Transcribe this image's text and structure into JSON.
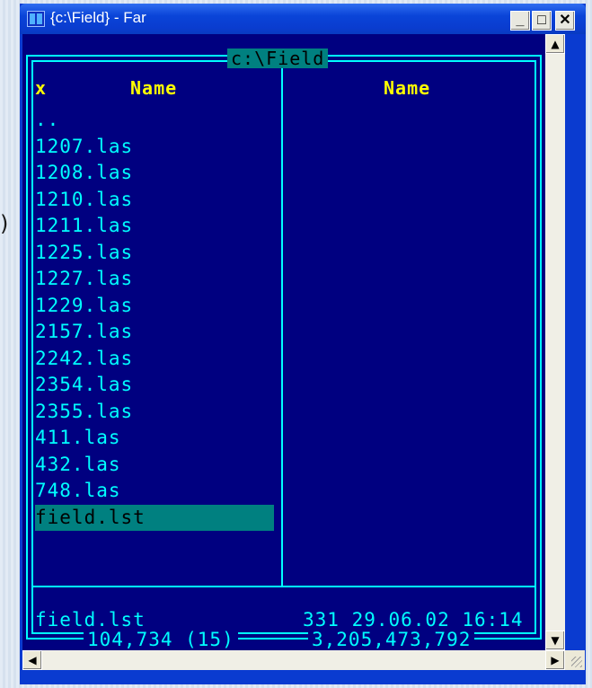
{
  "window": {
    "title": "{c:\\Field} - Far",
    "buttons": {
      "minimize": "_",
      "maximize": "□",
      "close": "✕"
    }
  },
  "panel": {
    "path": "c:\\Field",
    "sort_marker": "x",
    "left_header": "Name",
    "right_header": "Name",
    "files": [
      "..",
      "1207.las",
      "1208.las",
      "1210.las",
      "1211.las",
      "1225.las",
      "1227.las",
      "1229.las",
      "2157.las",
      "2242.las",
      "2354.las",
      "2355.las",
      "411.las",
      "432.las",
      "748.las",
      "field.lst"
    ],
    "selected_index": 15,
    "status": {
      "name": "field.lst",
      "info": "331 29.06.02 16:14"
    },
    "totals": {
      "files": "104,734 (15)",
      "free": "3,205,473,792"
    }
  },
  "scroll": {
    "up": "▲",
    "down": "▼",
    "left": "◀",
    "right": "▶"
  },
  "colors": {
    "console_bg": "#000080",
    "text": "#00ffff",
    "header": "#ffff00",
    "selection": "#008080",
    "titlebar": "#0a44d8"
  },
  "icons": {
    "app": "far-icon"
  }
}
